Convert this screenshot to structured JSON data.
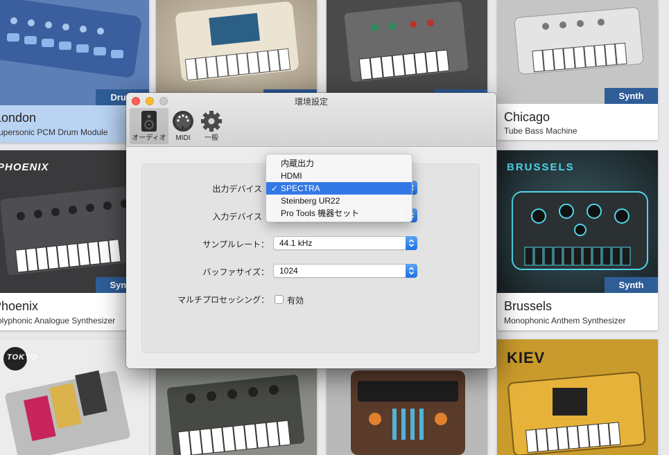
{
  "cards": [
    {
      "id": "london",
      "badge": "Drum",
      "name": "London",
      "desc": "Supersonic PCM Drum Module"
    },
    {
      "id": "card2",
      "badge": "Synth",
      "name": "",
      "desc": ""
    },
    {
      "id": "card3",
      "badge": "Synth",
      "name": "",
      "desc": ""
    },
    {
      "id": "chicago",
      "badge": "Synth",
      "name": "Chicago",
      "desc": "Tube Bass Machine"
    },
    {
      "id": "phoenix",
      "badge": "Synth",
      "name": "Phoenix",
      "desc": "Polyphonic Analogue Synthesizer",
      "logo": "PHOENIX"
    },
    {
      "id": "brussels",
      "badge": "Synth",
      "name": "Brussels",
      "desc": "Monophonic Anthem Synthesizer",
      "logo": "BRUSSELS"
    },
    {
      "id": "tokyo",
      "logo": "TOKYO"
    },
    {
      "id": "card8"
    },
    {
      "id": "card9"
    },
    {
      "id": "kiev",
      "logo": "KIEV"
    }
  ],
  "window": {
    "title": "環境設定",
    "toolbar": [
      {
        "label": "オーディオ",
        "icon": "speaker-icon",
        "active": true
      },
      {
        "label": "MIDI",
        "icon": "midi-port-icon",
        "active": false
      },
      {
        "label": "一般",
        "icon": "gear-icon",
        "active": false
      }
    ],
    "fields": {
      "output_label": "出力デバイス",
      "input_label": "入力デバイス",
      "sample_rate_label": "サンプルレート：",
      "sample_rate_value": "44.1 kHz",
      "buffer_label": "バッファサイズ：",
      "buffer_value": "1024",
      "multiproc_label": "マルチプロセッシング：",
      "multiproc_checkbox_label": "有効",
      "multiproc_checked": false
    },
    "output_menu": {
      "items": [
        "内蔵出力",
        "HDMI",
        "SPECTRA",
        "Steinberg UR22",
        "Pro Tools 機器セット"
      ],
      "selected": "SPECTRA",
      "check_glyph": "✓"
    }
  },
  "colors": {
    "badge": "#2e5d98",
    "menu_selection": "#3378e6",
    "stepper": "#1e6fe3",
    "close": "#fc5f57",
    "minimize": "#fdbc2e"
  }
}
